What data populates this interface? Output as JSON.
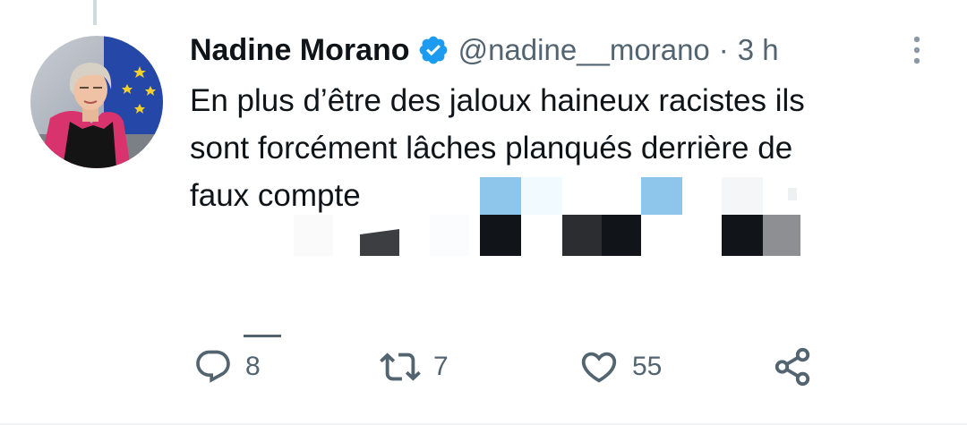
{
  "tweet": {
    "author_name": "Nadine Morano",
    "handle": "@nadine__morano",
    "separator": "·",
    "time": "3 h",
    "text_lines": [
      "En plus d’être des jaloux haineux racistes ils",
      "sont forcément lâches planqués derrière de",
      "faux compte"
    ]
  },
  "actions": {
    "reply_count": "8",
    "retweet_count": "7",
    "like_count": "55"
  },
  "icons": {
    "verified": "verified-badge-icon",
    "more": "more-options-icon",
    "reply": "reply-icon",
    "retweet": "retweet-icon",
    "like": "heart-icon",
    "share": "share-icon"
  },
  "colors": {
    "text": "#0f1419",
    "secondary": "#536471",
    "verified_blue": "#1d9bf0",
    "thread_line": "#cfd9de"
  }
}
